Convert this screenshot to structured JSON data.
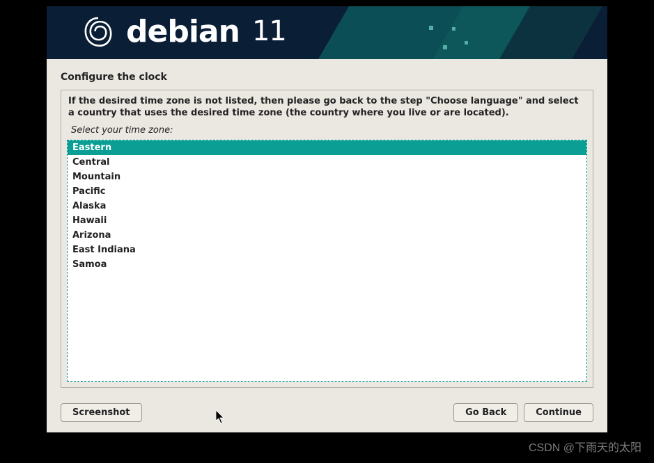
{
  "brand": {
    "name": "debian",
    "version": "11"
  },
  "page": {
    "title": "Configure the clock",
    "instruction": "If the desired time zone is not listed, then please go back to the step \"Choose language\" and select a country that uses the desired time zone (the country where you live or are located).",
    "prompt": "Select your time zone:"
  },
  "timezones": [
    {
      "label": "Eastern",
      "selected": true
    },
    {
      "label": "Central",
      "selected": false
    },
    {
      "label": "Mountain",
      "selected": false
    },
    {
      "label": "Pacific",
      "selected": false
    },
    {
      "label": "Alaska",
      "selected": false
    },
    {
      "label": "Hawaii",
      "selected": false
    },
    {
      "label": "Arizona",
      "selected": false
    },
    {
      "label": "East Indiana",
      "selected": false
    },
    {
      "label": "Samoa",
      "selected": false
    }
  ],
  "buttons": {
    "screenshot": "Screenshot",
    "go_back": "Go Back",
    "continue": "Continue"
  },
  "watermark": "CSDN @下雨天的太阳"
}
